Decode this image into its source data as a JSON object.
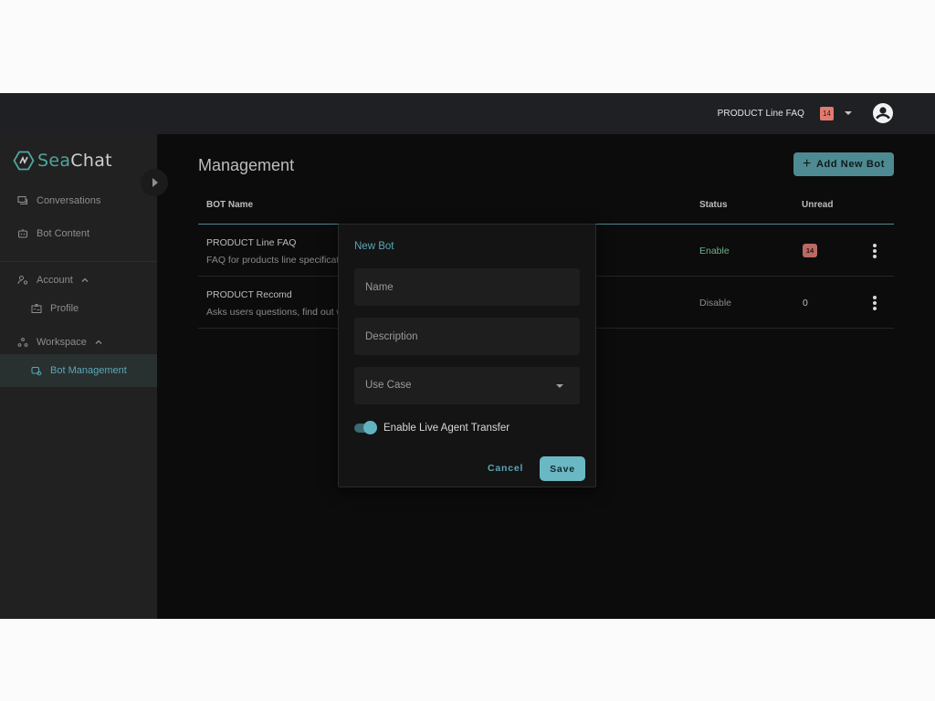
{
  "topbar": {
    "selected_bot": "PRODUCT Line  FAQ",
    "unread_badge": "14",
    "dropdown_icon": "caret-down-icon",
    "avatar_icon": "account-circle-icon"
  },
  "sidebar": {
    "logo": {
      "part1": "Sea",
      "part2": "Chat"
    },
    "items": [
      {
        "label": "Conversations",
        "icon": "chat-icon"
      },
      {
        "label": "Bot Content",
        "icon": "robot-icon"
      },
      {
        "label": "Account",
        "icon": "user-settings-icon",
        "expanded": true
      },
      {
        "label": "Profile",
        "icon": "id-badge-icon"
      },
      {
        "label": "Workspace",
        "icon": "nodes-icon",
        "expanded": true
      },
      {
        "label": "Bot Management",
        "icon": "bot-settings-icon",
        "active": true
      }
    ]
  },
  "main": {
    "title": "Management",
    "add_button": "Add New Bot",
    "table": {
      "columns": [
        "BOT Name",
        "Status",
        "Unread"
      ],
      "rows": [
        {
          "name": "PRODUCT Line  FAQ",
          "description": "FAQ for products line specifications",
          "status": "Enable",
          "unread": "14"
        },
        {
          "name": "PRODUCT Recomd",
          "description": "Asks users questions, find out what they need",
          "status": "Disable",
          "unread": "0"
        }
      ]
    }
  },
  "dialog": {
    "title": "New Bot",
    "name_placeholder": "Name",
    "description_placeholder": "Description",
    "use_case_label": "Use Case",
    "toggle_label": "Enable Live Agent Transfer",
    "toggle_on": true,
    "cancel": "Cancel",
    "save": "Save"
  },
  "colors": {
    "accent": "#5aa8b6",
    "enable_status": "#6fb08a",
    "disable_status": "#8a8a8a",
    "badge": "#e07b6f"
  }
}
